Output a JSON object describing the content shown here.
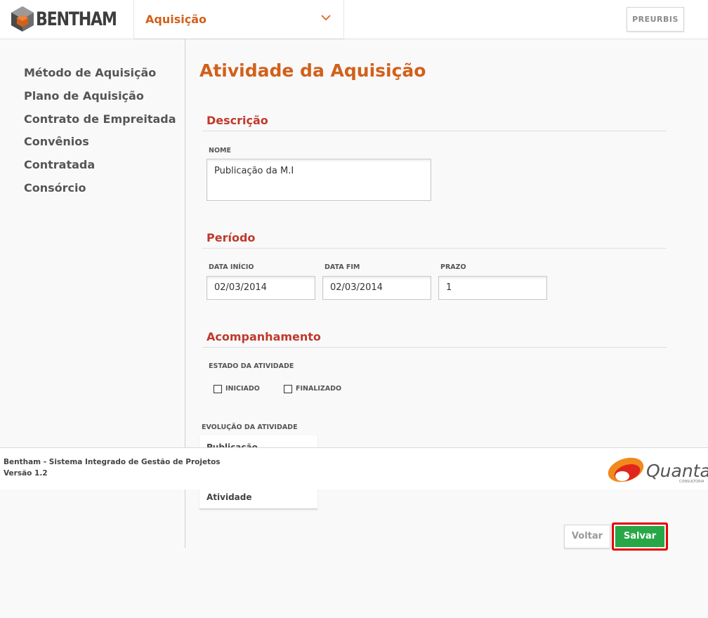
{
  "header": {
    "logo_text": "BENTHAM",
    "module_label": "Aquisição",
    "preurbis_label": "PREURBIS"
  },
  "sidebar": {
    "items": [
      {
        "label": "Método de Aquisição"
      },
      {
        "label": "Plano de Aquisição"
      },
      {
        "label": "Contrato de Empreitada"
      },
      {
        "label": "Convênios"
      },
      {
        "label": "Contratada"
      },
      {
        "label": "Consórcio"
      }
    ]
  },
  "main": {
    "title": "Atividade da Aquisição",
    "descricao": {
      "title": "Descrição",
      "nome_label": "NOME",
      "nome_value": "Publicação da M.I"
    },
    "periodo": {
      "title": "Período",
      "data_inicio_label": "DATA INÍCIO",
      "data_inicio_value": "02/03/2014",
      "data_fim_label": "DATA FIM",
      "data_fim_value": "02/03/2014",
      "prazo_label": "PRAZO",
      "prazo_value": "1"
    },
    "acompanhamento": {
      "title": "Acompanhamento",
      "estado_label": "ESTADO DA ATIVIDADE",
      "iniciado_label": "INICIADO",
      "iniciado_checked": false,
      "finalizado_label": "FINALIZADO",
      "finalizado_checked": false
    },
    "evolucao": {
      "label": "EVOLUÇÃO DA ATIVIDADE",
      "option_top": "Publicação",
      "option_bottom": "Atividade"
    },
    "buttons": {
      "voltar": "Voltar",
      "salvar": "Salvar"
    }
  },
  "footer": {
    "line1": "Bentham - Sistema Integrado de Gestão de Projetos",
    "line2": "Versão 1.2",
    "brand": "Quanta",
    "brand_sub": "CONSULTORIA"
  },
  "colors": {
    "accent_orange": "#d2601a",
    "section_red": "#c0392b",
    "save_green": "#27a745",
    "highlight_red": "#e20000"
  }
}
